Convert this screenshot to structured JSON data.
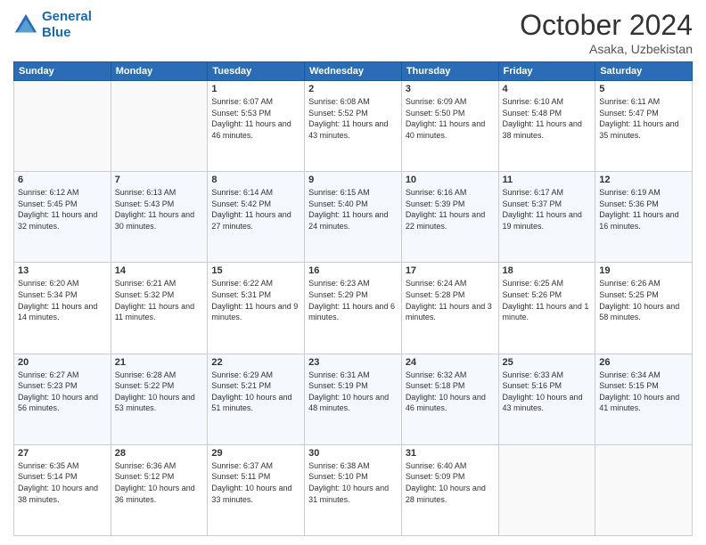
{
  "header": {
    "logo_line1": "General",
    "logo_line2": "Blue",
    "month": "October 2024",
    "location": "Asaka, Uzbekistan"
  },
  "days_of_week": [
    "Sunday",
    "Monday",
    "Tuesday",
    "Wednesday",
    "Thursday",
    "Friday",
    "Saturday"
  ],
  "weeks": [
    [
      {
        "day": "",
        "info": ""
      },
      {
        "day": "",
        "info": ""
      },
      {
        "day": "1",
        "info": "Sunrise: 6:07 AM\nSunset: 5:53 PM\nDaylight: 11 hours and 46 minutes."
      },
      {
        "day": "2",
        "info": "Sunrise: 6:08 AM\nSunset: 5:52 PM\nDaylight: 11 hours and 43 minutes."
      },
      {
        "day": "3",
        "info": "Sunrise: 6:09 AM\nSunset: 5:50 PM\nDaylight: 11 hours and 40 minutes."
      },
      {
        "day": "4",
        "info": "Sunrise: 6:10 AM\nSunset: 5:48 PM\nDaylight: 11 hours and 38 minutes."
      },
      {
        "day": "5",
        "info": "Sunrise: 6:11 AM\nSunset: 5:47 PM\nDaylight: 11 hours and 35 minutes."
      }
    ],
    [
      {
        "day": "6",
        "info": "Sunrise: 6:12 AM\nSunset: 5:45 PM\nDaylight: 11 hours and 32 minutes."
      },
      {
        "day": "7",
        "info": "Sunrise: 6:13 AM\nSunset: 5:43 PM\nDaylight: 11 hours and 30 minutes."
      },
      {
        "day": "8",
        "info": "Sunrise: 6:14 AM\nSunset: 5:42 PM\nDaylight: 11 hours and 27 minutes."
      },
      {
        "day": "9",
        "info": "Sunrise: 6:15 AM\nSunset: 5:40 PM\nDaylight: 11 hours and 24 minutes."
      },
      {
        "day": "10",
        "info": "Sunrise: 6:16 AM\nSunset: 5:39 PM\nDaylight: 11 hours and 22 minutes."
      },
      {
        "day": "11",
        "info": "Sunrise: 6:17 AM\nSunset: 5:37 PM\nDaylight: 11 hours and 19 minutes."
      },
      {
        "day": "12",
        "info": "Sunrise: 6:19 AM\nSunset: 5:36 PM\nDaylight: 11 hours and 16 minutes."
      }
    ],
    [
      {
        "day": "13",
        "info": "Sunrise: 6:20 AM\nSunset: 5:34 PM\nDaylight: 11 hours and 14 minutes."
      },
      {
        "day": "14",
        "info": "Sunrise: 6:21 AM\nSunset: 5:32 PM\nDaylight: 11 hours and 11 minutes."
      },
      {
        "day": "15",
        "info": "Sunrise: 6:22 AM\nSunset: 5:31 PM\nDaylight: 11 hours and 9 minutes."
      },
      {
        "day": "16",
        "info": "Sunrise: 6:23 AM\nSunset: 5:29 PM\nDaylight: 11 hours and 6 minutes."
      },
      {
        "day": "17",
        "info": "Sunrise: 6:24 AM\nSunset: 5:28 PM\nDaylight: 11 hours and 3 minutes."
      },
      {
        "day": "18",
        "info": "Sunrise: 6:25 AM\nSunset: 5:26 PM\nDaylight: 11 hours and 1 minute."
      },
      {
        "day": "19",
        "info": "Sunrise: 6:26 AM\nSunset: 5:25 PM\nDaylight: 10 hours and 58 minutes."
      }
    ],
    [
      {
        "day": "20",
        "info": "Sunrise: 6:27 AM\nSunset: 5:23 PM\nDaylight: 10 hours and 56 minutes."
      },
      {
        "day": "21",
        "info": "Sunrise: 6:28 AM\nSunset: 5:22 PM\nDaylight: 10 hours and 53 minutes."
      },
      {
        "day": "22",
        "info": "Sunrise: 6:29 AM\nSunset: 5:21 PM\nDaylight: 10 hours and 51 minutes."
      },
      {
        "day": "23",
        "info": "Sunrise: 6:31 AM\nSunset: 5:19 PM\nDaylight: 10 hours and 48 minutes."
      },
      {
        "day": "24",
        "info": "Sunrise: 6:32 AM\nSunset: 5:18 PM\nDaylight: 10 hours and 46 minutes."
      },
      {
        "day": "25",
        "info": "Sunrise: 6:33 AM\nSunset: 5:16 PM\nDaylight: 10 hours and 43 minutes."
      },
      {
        "day": "26",
        "info": "Sunrise: 6:34 AM\nSunset: 5:15 PM\nDaylight: 10 hours and 41 minutes."
      }
    ],
    [
      {
        "day": "27",
        "info": "Sunrise: 6:35 AM\nSunset: 5:14 PM\nDaylight: 10 hours and 38 minutes."
      },
      {
        "day": "28",
        "info": "Sunrise: 6:36 AM\nSunset: 5:12 PM\nDaylight: 10 hours and 36 minutes."
      },
      {
        "day": "29",
        "info": "Sunrise: 6:37 AM\nSunset: 5:11 PM\nDaylight: 10 hours and 33 minutes."
      },
      {
        "day": "30",
        "info": "Sunrise: 6:38 AM\nSunset: 5:10 PM\nDaylight: 10 hours and 31 minutes."
      },
      {
        "day": "31",
        "info": "Sunrise: 6:40 AM\nSunset: 5:09 PM\nDaylight: 10 hours and 28 minutes."
      },
      {
        "day": "",
        "info": ""
      },
      {
        "day": "",
        "info": ""
      }
    ]
  ]
}
